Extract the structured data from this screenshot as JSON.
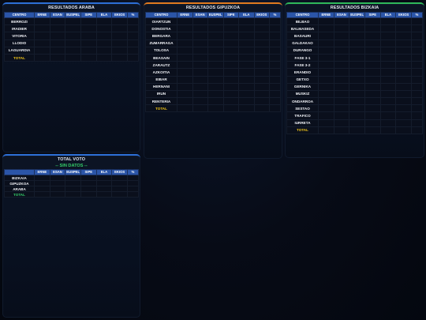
{
  "columns": [
    "CENTRO",
    "ERNE",
    "ESAN",
    "EUSPEL",
    "SIPE",
    "ELA",
    "EKIOS",
    "%"
  ],
  "araba": {
    "title": "RESULTADOS ARABA",
    "rows": [
      "BERROZI",
      "IRADIER",
      "VITORIA",
      "LLODIO",
      "LAGUARDIA"
    ],
    "total_label": "TOTAL",
    "accent": "#2d6fd6"
  },
  "gipuzkoa": {
    "title": "RESULTADOS GIPUZKOA",
    "rows": [
      "OIARTZUN",
      "DONOSTIA",
      "BERGARA",
      "ZUMARRAGA",
      "TOLOSA",
      "BEASAIN",
      "ZARAUTZ",
      "AZKOITIA",
      "EIBAR",
      "HERNANI",
      "IRUN",
      "RENTERIA"
    ],
    "total_label": "TOTAL",
    "accent": "#e07a1f"
  },
  "bizkaia": {
    "title": "RESULTADOS BIZKAIA",
    "rows": [
      "BILBAO",
      "BALMASEDA",
      "BASAURI",
      "GALDAKAO",
      "DURANGO",
      "FASE 3-1",
      "FASE 3-2",
      "ERANDIO",
      "GETXO",
      "GERNIKA",
      "MUSKIZ",
      "ONDARROA",
      "SESTAO",
      "TRAFICO",
      "IURRETA"
    ],
    "total_label": "TOTAL",
    "accent": "#2fb85a"
  },
  "total_voto": {
    "title": "TOTAL VOTO",
    "subtitle": "-- SIN DATOS --",
    "rows": [
      "BIZKAIA",
      "GIPUZKOA",
      "ARABA"
    ],
    "total_label": "TOTAL",
    "accent": "#2d6fd6"
  }
}
